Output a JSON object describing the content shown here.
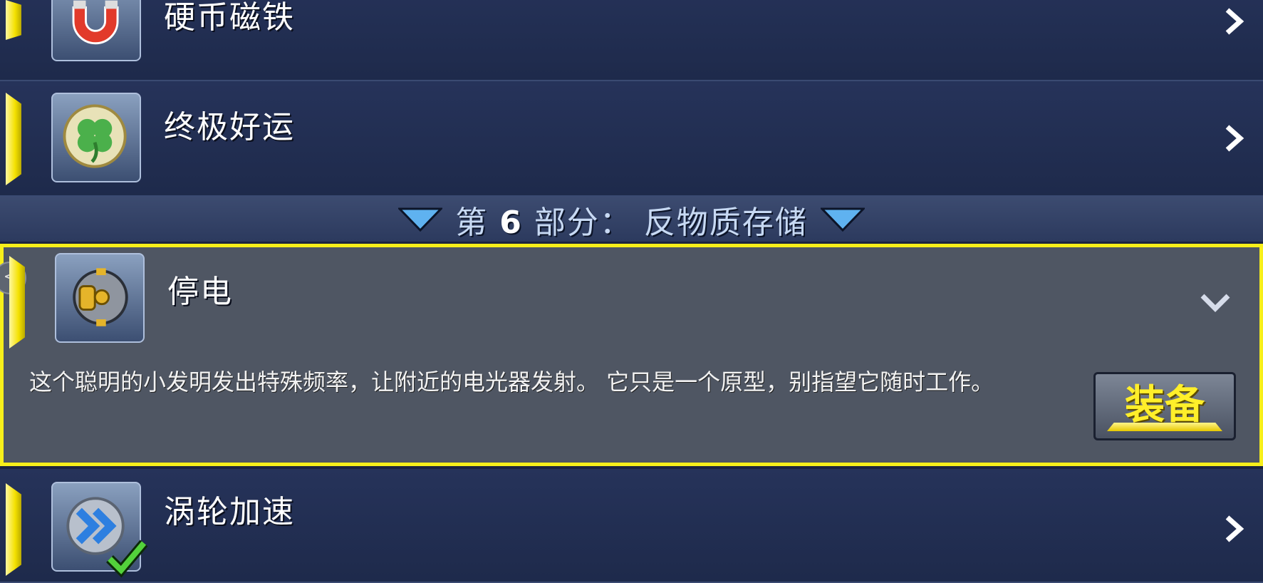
{
  "colors": {
    "accent_yellow": "#f7ef1a",
    "row_bg": "#1e2a4b",
    "expanded_bg": "#4f5663",
    "header_text": "#c7d9f3",
    "equip_text": "#ffef2a"
  },
  "items_top": [
    {
      "title": "硬币磁铁",
      "icon": "magnet-icon"
    },
    {
      "title": "终极好运",
      "icon": "four-leaf-clover-icon"
    }
  ],
  "section": {
    "prefix": "第",
    "number": "6",
    "suffix": "部分：",
    "name": "反物质存储"
  },
  "expanded_item": {
    "title": "停电",
    "icon": "power-cell-icon",
    "description": "这个聪明的小发明发出特殊频率，让附近的电光器发射。 它只是一个原型，别指望它随时工作。",
    "equip_label": "装备",
    "side_nub": "<"
  },
  "items_bottom": [
    {
      "title": "涡轮加速",
      "icon": "double-arrow-icon",
      "equipped": true
    }
  ]
}
